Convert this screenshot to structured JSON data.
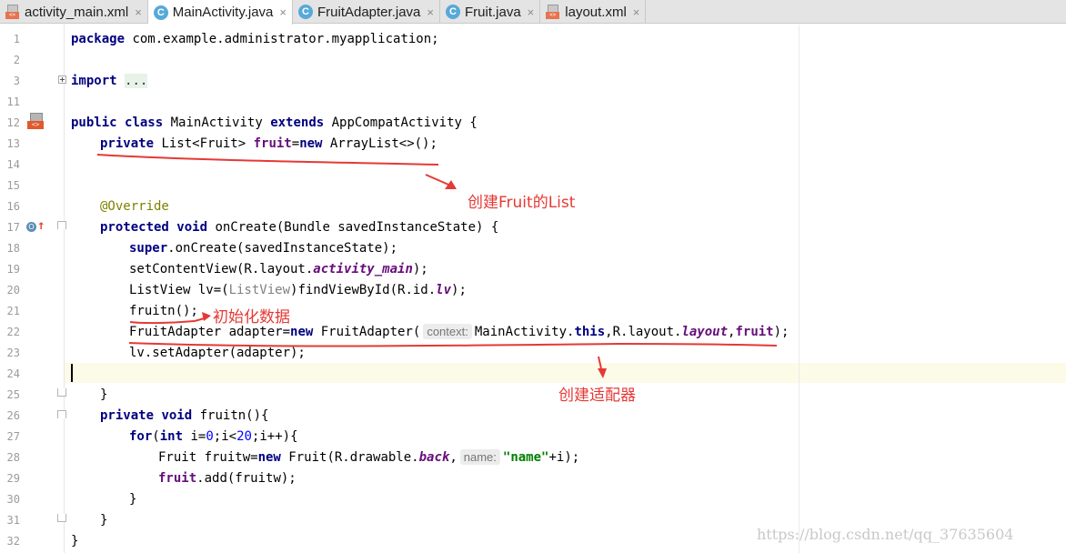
{
  "tabs": [
    {
      "label": "activity_main.xml",
      "icon": "xml-file-icon",
      "close": "×"
    },
    {
      "label": "MainActivity.java",
      "icon": "class-file-icon",
      "close": "×",
      "active": true
    },
    {
      "label": "FruitAdapter.java",
      "icon": "class-file-icon",
      "close": "×"
    },
    {
      "label": "Fruit.java",
      "icon": "class-file-icon",
      "close": "×"
    },
    {
      "label": "layout.xml",
      "icon": "xml-file-icon",
      "close": "×"
    }
  ],
  "icon_text": {
    "class_letter": "C",
    "xml_badge": "<>",
    "override_letter": "O",
    "override_arrow": "↑"
  },
  "line_numbers": [
    "1",
    "2",
    "3",
    "11",
    "12",
    "13",
    "14",
    "15",
    "16",
    "17",
    "18",
    "19",
    "20",
    "21",
    "22",
    "23",
    "24",
    "25",
    "26",
    "27",
    "28",
    "29",
    "30",
    "31",
    "32"
  ],
  "code": {
    "l1": {
      "kw": "package",
      "rest": " com.example.administrator.myapplication;"
    },
    "l3": {
      "kw": "import",
      "fold": "..."
    },
    "l12": {
      "kw1": "public",
      "kw2": "class",
      "name": " MainActivity ",
      "kw3": "extends",
      "rest": " AppCompatActivity {"
    },
    "l13": {
      "kw": "private",
      "type": " List<Fruit> ",
      "field": "fruit",
      "eq": "=",
      "kw2": "new",
      "rest": " ArrayList<>();"
    },
    "l16": {
      "ann": "@Override"
    },
    "l17": {
      "kw1": "protected",
      "kw2": "void",
      "rest": " onCreate(Bundle savedInstanceState) {"
    },
    "l18": {
      "kw": "super",
      "rest": ".onCreate(savedInstanceState);"
    },
    "l19": {
      "pre": "setContentView(R.layout.",
      "field": "activity_main",
      "post": ");"
    },
    "l20": {
      "pre": "ListView lv=(",
      "cast": "ListView",
      "mid": ")findViewById(R.id.",
      "field": "lv",
      "post": ");"
    },
    "l21": {
      "text": "fruitn();"
    },
    "l22": {
      "pre": "FruitAdapter adapter=",
      "kw": "new",
      "mid": " FruitAdapter(",
      "hint": "context:",
      "arg1": "MainActivity.",
      "kw2": "this",
      "mid2": ",R.layout.",
      "field": "layout",
      "comma": ",",
      "field2": "fruit",
      "post": ");"
    },
    "l23": {
      "text": "lv.setAdapter(adapter);"
    },
    "l25": {
      "text": "}"
    },
    "l26": {
      "kw1": "private",
      "kw2": "void",
      "rest": " fruitn(){"
    },
    "l27": {
      "kw1": "for",
      "p1": "(",
      "kw2": "int",
      "p2": " i=",
      "n1": "0",
      "p3": ";i<",
      "n2": "20",
      "p4": ";i++){"
    },
    "l28": {
      "pre": "Fruit fruitw=",
      "kw": "new",
      "mid": " Fruit(R.drawable.",
      "field": "back",
      "comma": ",",
      "hint": "name:",
      "str": "\"name\"",
      "post": "+i);"
    },
    "l29": {
      "field": "fruit",
      "post": ".add(fruitw);"
    },
    "l30": {
      "text": "}"
    },
    "l31": {
      "text": "}"
    },
    "l32": {
      "text": "}"
    }
  },
  "annotations": {
    "create_list": "创建Fruit的List",
    "init_data": "初始化数据",
    "create_adapter": "创建适配器",
    "arrow_color": "#e53935"
  },
  "watermark": "https://blog.csdn.net/qq_37635604"
}
